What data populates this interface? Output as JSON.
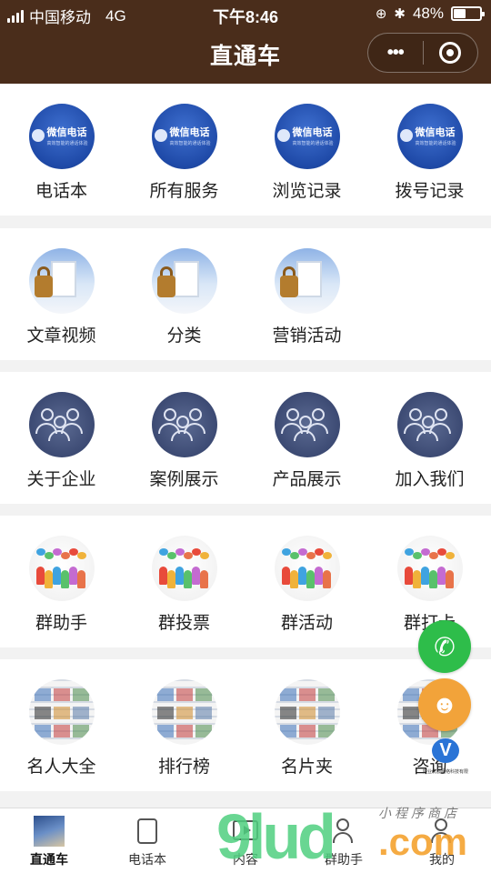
{
  "status_bar": {
    "carrier": "中国移动",
    "network": "4G",
    "time": "下午8:46",
    "battery": "48%",
    "battery_level": 0.48
  },
  "nav": {
    "title": "直通车",
    "more_icon": "more-dots-icon",
    "close_icon": "target-circle-icon"
  },
  "thumb_text": {
    "wechat_title": "微信电话",
    "wechat_sub": "高效智能的通话体验"
  },
  "sections": [
    {
      "items": [
        {
          "label": "电话本",
          "thumb": "wechat"
        },
        {
          "label": "所有服务",
          "thumb": "wechat"
        },
        {
          "label": "浏览记录",
          "thumb": "wechat"
        },
        {
          "label": "拨号记录",
          "thumb": "wechat"
        }
      ]
    },
    {
      "items": [
        {
          "label": "文章视频",
          "thumb": "lock"
        },
        {
          "label": "分类",
          "thumb": "lock"
        },
        {
          "label": "营销活动",
          "thumb": "lock"
        }
      ]
    },
    {
      "items": [
        {
          "label": "关于企业",
          "thumb": "people"
        },
        {
          "label": "案例展示",
          "thumb": "people"
        },
        {
          "label": "产品展示",
          "thumb": "people"
        },
        {
          "label": "加入我们",
          "thumb": "people"
        }
      ]
    },
    {
      "items": [
        {
          "label": "群助手",
          "thumb": "crowd"
        },
        {
          "label": "群投票",
          "thumb": "crowd"
        },
        {
          "label": "群活动",
          "thumb": "crowd"
        },
        {
          "label": "群打卡",
          "thumb": "crowd"
        }
      ]
    },
    {
      "items": [
        {
          "label": "名人大全",
          "thumb": "news"
        },
        {
          "label": "排行榜",
          "thumb": "news"
        },
        {
          "label": "名片夹",
          "thumb": "news"
        },
        {
          "label": "咨询",
          "thumb": "news"
        }
      ]
    }
  ],
  "floating": {
    "phone_icon": "phone-icon",
    "service_icon": "customer-service-icon",
    "logo_text": "好业优服网络科技有限"
  },
  "tabbar": {
    "tabs": [
      {
        "label": "直通车",
        "icon": "cover-image-icon",
        "active": true
      },
      {
        "label": "电话本",
        "icon": "phonebook-icon",
        "active": false
      },
      {
        "label": "内容",
        "icon": "video-play-icon",
        "active": false
      },
      {
        "label": "群助手",
        "icon": "group-icon",
        "active": false
      },
      {
        "label": "我的",
        "icon": "profile-icon",
        "active": false
      }
    ]
  },
  "watermark": {
    "main": "9lud",
    "suffix": ".com",
    "small": "小程序商店"
  },
  "colors": {
    "nav_bg": "#4a2d1b",
    "phone_button": "#2ebd4a",
    "service_button": "#f2a33a",
    "page_bg": "#f2f2f2"
  }
}
